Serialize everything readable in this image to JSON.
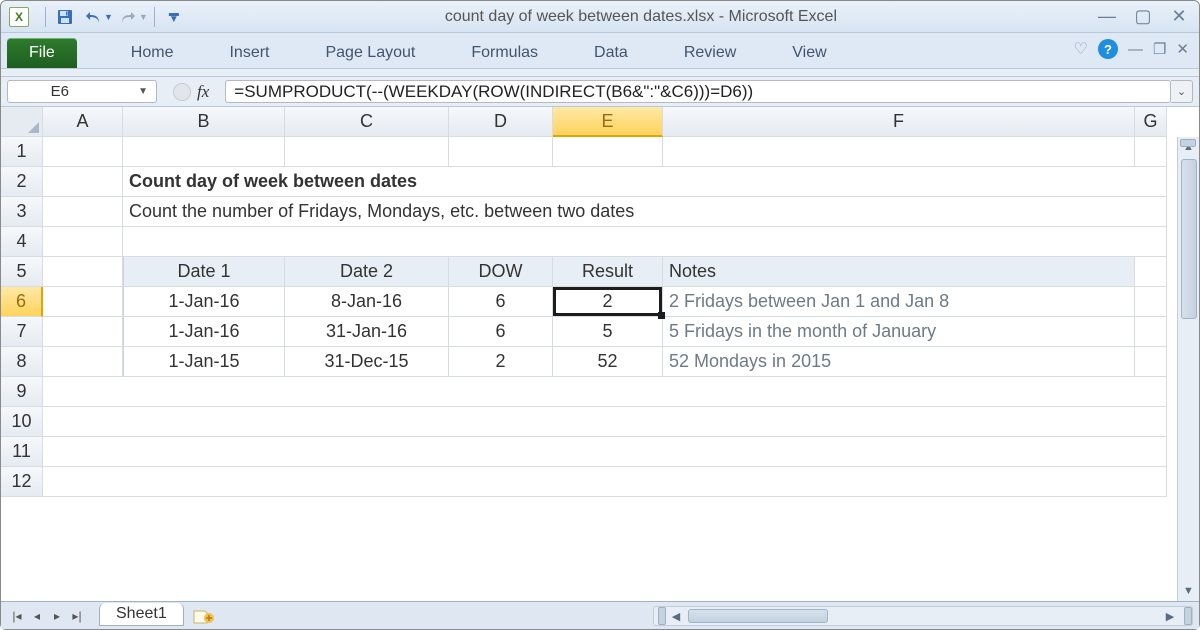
{
  "title": "count day of week between dates.xlsx - Microsoft Excel",
  "qat": {
    "save": "save-icon",
    "undo": "undo-icon",
    "redo": "redo-icon"
  },
  "ribbon": {
    "file": "File",
    "tabs": [
      "Home",
      "Insert",
      "Page Layout",
      "Formulas",
      "Data",
      "Review",
      "View"
    ]
  },
  "namebox": {
    "value": "E6"
  },
  "formula": {
    "label": "fx",
    "value": "=SUMPRODUCT(--(WEEKDAY(ROW(INDIRECT(B6&\":\"&C6)))=D6))"
  },
  "columns": [
    "A",
    "B",
    "C",
    "D",
    "E",
    "F",
    "G"
  ],
  "rows": [
    "1",
    "2",
    "3",
    "4",
    "5",
    "6",
    "7",
    "8",
    "9",
    "10",
    "11",
    "12"
  ],
  "selected": {
    "col": "E",
    "row": "6"
  },
  "content": {
    "heading": "Count day of week between dates",
    "subheading": "Count the number of Fridays, Mondays, etc. between two dates",
    "headers": {
      "b": "Date 1",
      "c": "Date 2",
      "d": "DOW",
      "e": "Result",
      "f": "Notes"
    },
    "data": [
      {
        "b": "1-Jan-16",
        "c": "8-Jan-16",
        "d": "6",
        "e": "2",
        "f": "2 Fridays between Jan 1 and Jan 8"
      },
      {
        "b": "1-Jan-16",
        "c": "31-Jan-16",
        "d": "6",
        "e": "5",
        "f": "5 Fridays in the month of January"
      },
      {
        "b": "1-Jan-15",
        "c": "31-Dec-15",
        "d": "2",
        "e": "52",
        "f": "52 Mondays in 2015"
      }
    ]
  },
  "sheet": {
    "name": "Sheet1"
  }
}
